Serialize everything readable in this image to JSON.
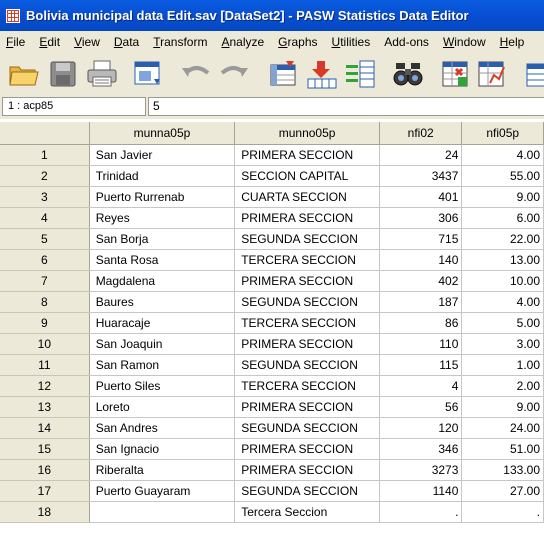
{
  "window": {
    "title": "Bolivia municipal data Edit.sav [DataSet2] - PASW Statistics Data Editor"
  },
  "menu": [
    {
      "label": "File",
      "ul": "F",
      "rest": "ile"
    },
    {
      "label": "Edit",
      "ul": "E",
      "rest": "dit"
    },
    {
      "label": "View",
      "ul": "V",
      "rest": "iew"
    },
    {
      "label": "Data",
      "ul": "D",
      "rest": "ata"
    },
    {
      "label": "Transform",
      "ul": "T",
      "rest": "ransform"
    },
    {
      "label": "Analyze",
      "ul": "A",
      "rest": "nalyze"
    },
    {
      "label": "Graphs",
      "ul": "G",
      "rest": "raphs"
    },
    {
      "label": "Utilities",
      "ul": "U",
      "rest": "tilities"
    },
    {
      "label": "Add-ons",
      "ul": "",
      "rest": "Add-ons"
    },
    {
      "label": "Window",
      "ul": "W",
      "rest": "indow"
    },
    {
      "label": "Help",
      "ul": "H",
      "rest": "elp"
    }
  ],
  "toolbar": {
    "icons": [
      "open-folder-icon",
      "save-icon",
      "print-icon",
      "dialog-recall-icon",
      "undo-icon",
      "redo-icon",
      "goto-case-icon",
      "goto-variable-icon",
      "variables-icon",
      "find-icon",
      "insert-cases-icon",
      "split-file-icon",
      "weight-cases-icon"
    ]
  },
  "cell_editor": {
    "reference": "1 : acp85",
    "value": "5"
  },
  "grid": {
    "columns": [
      "munna05p",
      "munno05p",
      "nfi02",
      "nfi05p"
    ],
    "rows": [
      {
        "n": "1",
        "munna05p": "San Javier",
        "munno05p": "PRIMERA SECCION",
        "nfi02": "24",
        "nfi05p": "4.00"
      },
      {
        "n": "2",
        "munna05p": "Trinidad",
        "munno05p": "SECCION CAPITAL",
        "nfi02": "3437",
        "nfi05p": "55.00"
      },
      {
        "n": "3",
        "munna05p": "Puerto Rurrenab",
        "munno05p": "CUARTA SECCION",
        "nfi02": "401",
        "nfi05p": "9.00"
      },
      {
        "n": "4",
        "munna05p": "Reyes",
        "munno05p": "PRIMERA SECCION",
        "nfi02": "306",
        "nfi05p": "6.00"
      },
      {
        "n": "5",
        "munna05p": "San Borja",
        "munno05p": "SEGUNDA SECCION",
        "nfi02": "715",
        "nfi05p": "22.00"
      },
      {
        "n": "6",
        "munna05p": "Santa Rosa",
        "munno05p": "TERCERA SECCION",
        "nfi02": "140",
        "nfi05p": "13.00"
      },
      {
        "n": "7",
        "munna05p": "Magdalena",
        "munno05p": "PRIMERA SECCION",
        "nfi02": "402",
        "nfi05p": "10.00"
      },
      {
        "n": "8",
        "munna05p": "Baures",
        "munno05p": "SEGUNDA SECCION",
        "nfi02": "187",
        "nfi05p": "4.00"
      },
      {
        "n": "9",
        "munna05p": "Huaracaje",
        "munno05p": "TERCERA SECCION",
        "nfi02": "86",
        "nfi05p": "5.00"
      },
      {
        "n": "10",
        "munna05p": "San Joaquin",
        "munno05p": "PRIMERA SECCION",
        "nfi02": "110",
        "nfi05p": "3.00"
      },
      {
        "n": "11",
        "munna05p": "San Ramon",
        "munno05p": "SEGUNDA SECCION",
        "nfi02": "115",
        "nfi05p": "1.00"
      },
      {
        "n": "12",
        "munna05p": "Puerto Siles",
        "munno05p": "TERCERA SECCION",
        "nfi02": "4",
        "nfi05p": "2.00"
      },
      {
        "n": "13",
        "munna05p": "Loreto",
        "munno05p": "PRIMERA SECCION",
        "nfi02": "56",
        "nfi05p": "9.00"
      },
      {
        "n": "14",
        "munna05p": "San Andres",
        "munno05p": "SEGUNDA SECCION",
        "nfi02": "120",
        "nfi05p": "24.00"
      },
      {
        "n": "15",
        "munna05p": "San Ignacio",
        "munno05p": "PRIMERA SECCION",
        "nfi02": "346",
        "nfi05p": "51.00"
      },
      {
        "n": "16",
        "munna05p": "Riberalta",
        "munno05p": "PRIMERA SECCION",
        "nfi02": "3273",
        "nfi05p": "133.00"
      },
      {
        "n": "17",
        "munna05p": "Puerto Guayaram",
        "munno05p": "SEGUNDA SECCION",
        "nfi02": "1140",
        "nfi05p": "27.00"
      },
      {
        "n": "18",
        "munna05p": "",
        "munno05p": "Tercera Seccion",
        "nfi02": ".",
        "nfi05p": "."
      }
    ]
  }
}
